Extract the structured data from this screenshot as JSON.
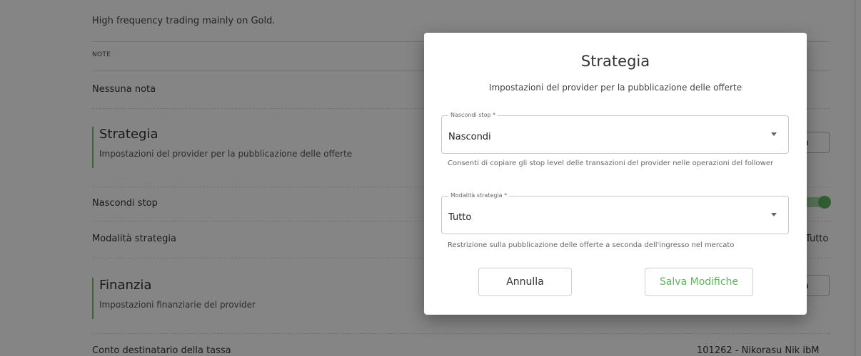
{
  "background": {
    "description_text": "High frequency trading mainly on Gold.",
    "note_heading": "NOTE",
    "note_value": "Nessuna nota",
    "strategy_section": {
      "title": "Strategia",
      "subtitle": "Impostazioni del provider per la pubblicazione delle offerte",
      "edit_label_partial": "ca"
    },
    "rows": [
      {
        "label": "Nascondi stop"
      },
      {
        "label": "Modalità strategia",
        "value": "Tutto"
      }
    ],
    "finance_section": {
      "title": "Finanzia",
      "subtitle": "Impostazioni finanziarie del provider",
      "edit_label_partial": "ca"
    },
    "fee_account": {
      "label": "Conto destinatario della tassa",
      "value": "101262 - Nikorasu Nik ibM"
    }
  },
  "modal": {
    "title": "Strategia",
    "subtitle": "Impostazioni del provider per la pubblicazione delle offerte",
    "fields": [
      {
        "legend": "Nascondi stop *",
        "value": "Nascondi",
        "helper": "Consenti di copiare gli stop level delle transazioni del provider nelle operazioni del follower"
      },
      {
        "legend": "Modalità strategia *",
        "value": "Tutto",
        "helper": "Restrizione sulla pubblicazione delle offerte a seconda dell'ingresso nel mercato"
      }
    ],
    "cancel_label": "Annulla",
    "save_label": "Salva Modifiche"
  },
  "colors": {
    "accent_green": "#5fb35f",
    "overlay": "rgba(0,0,0,0.48)"
  }
}
